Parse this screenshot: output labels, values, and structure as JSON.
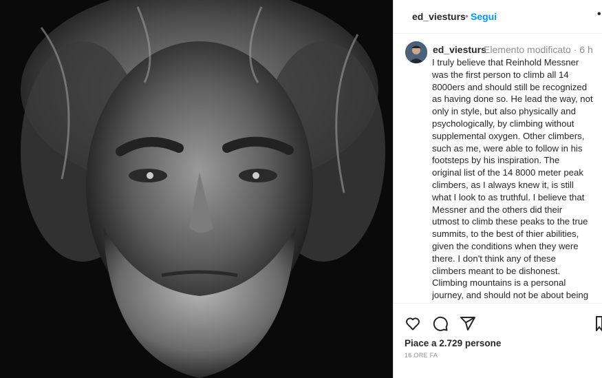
{
  "post": {
    "image_alt": "Black and white close-up portrait of a bearded man"
  },
  "header": {
    "username": "ed_viesturs",
    "separator": "•",
    "follow_label": "Segui",
    "more_label": "•"
  },
  "caption": {
    "username": "ed_viesturs",
    "edited_label": "Elemento modificato · 6 h",
    "lines": [
      "I truly believe that Reinhold Messner",
      "was the first person to climb all 14",
      "8000ers and should still be recognized",
      "as having done so. He lead the way, not",
      "only in style, but also physically and",
      "psychologically, by climbing without",
      "supplemental oxygen. Other climbers,",
      "such as me, were able to follow in his",
      "footsteps by his inspiration. The",
      "original list of the 14 8000 meter peak",
      "climbers, as I always knew it, is still",
      "what I look to as truthful. I believe that",
      "Messner and the others did their",
      "utmost to climb these peaks to the true",
      "summits, to the best of thier abilities,",
      "given the conditions when they were",
      "there. I don't think any of these",
      "climbers meant to be dishonest.",
      "Climbing mountains is a personal",
      "journey, and should not be about being"
    ]
  },
  "actions": {
    "icons": [
      "heart-icon",
      "comment-icon",
      "share-icon",
      "bookmark-icon"
    ]
  },
  "stats": {
    "likes_text": "Piace a 2.729 persone",
    "time_text": "16 ORE FA"
  },
  "colors": {
    "link": "#0095f6",
    "muted": "#8e8e8e",
    "text": "#262626"
  }
}
